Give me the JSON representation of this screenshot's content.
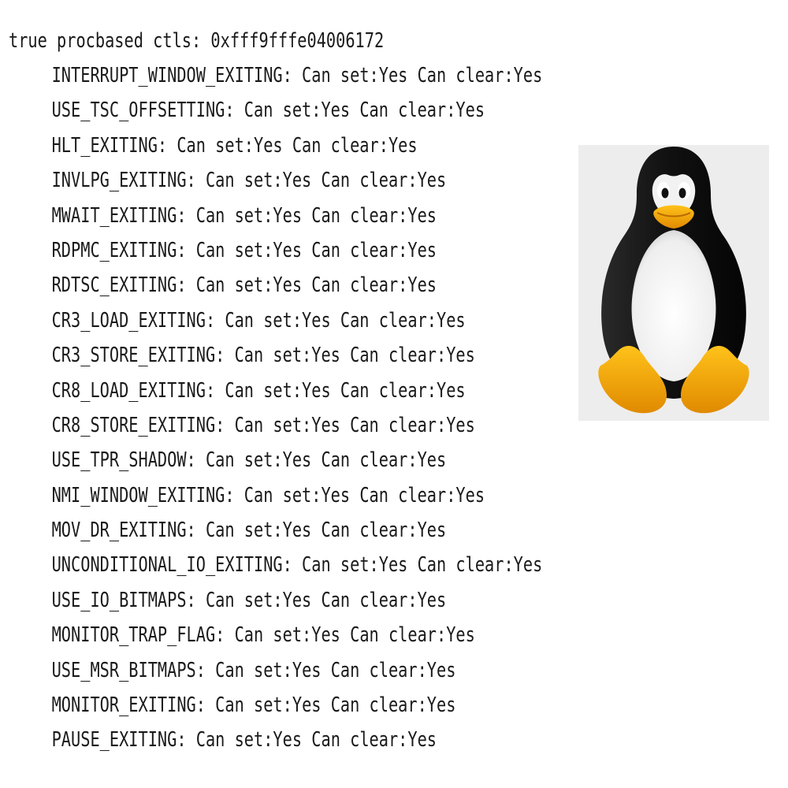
{
  "output": {
    "header": "true procbased ctls: 0xfff9fffe04006172",
    "controls": [
      {
        "name": "INTERRUPT_WINDOW_EXITING",
        "status": "Can set:Yes Can clear:Yes"
      },
      {
        "name": "USE_TSC_OFFSETTING",
        "status": "Can set:Yes Can clear:Yes"
      },
      {
        "name": "HLT_EXITING",
        "status": "Can set:Yes Can clear:Yes"
      },
      {
        "name": "INVLPG_EXITING",
        "status": "Can set:Yes Can clear:Yes"
      },
      {
        "name": "MWAIT_EXITING",
        "status": "Can set:Yes Can clear:Yes"
      },
      {
        "name": "RDPMC_EXITING",
        "status": "Can set:Yes Can clear:Yes"
      },
      {
        "name": "RDTSC_EXITING",
        "status": "Can set:Yes Can clear:Yes"
      },
      {
        "name": "CR3_LOAD_EXITING",
        "status": "Can set:Yes Can clear:Yes"
      },
      {
        "name": "CR3_STORE_EXITING",
        "status": "Can set:Yes Can clear:Yes"
      },
      {
        "name": "CR8_LOAD_EXITING",
        "status": "Can set:Yes Can clear:Yes"
      },
      {
        "name": "CR8_STORE_EXITING",
        "status": "Can set:Yes Can clear:Yes"
      },
      {
        "name": "USE_TPR_SHADOW",
        "status": "Can set:Yes Can clear:Yes"
      },
      {
        "name": "NMI_WINDOW_EXITING",
        "status": "Can set:Yes Can clear:Yes"
      },
      {
        "name": "MOV_DR_EXITING",
        "status": "Can set:Yes Can clear:Yes"
      },
      {
        "name": "UNCONDITIONAL_IO_EXITING",
        "status": "Can set:Yes Can clear:Yes"
      },
      {
        "name": "USE_IO_BITMAPS",
        "status": "Can set:Yes Can clear:Yes"
      },
      {
        "name": "MONITOR_TRAP_FLAG",
        "status": "Can set:Yes Can clear:Yes"
      },
      {
        "name": "USE_MSR_BITMAPS",
        "status": "Can set:Yes Can clear:Yes"
      },
      {
        "name": "MONITOR_EXITING",
        "status": "Can set:Yes Can clear:Yes"
      },
      {
        "name": "PAUSE_EXITING",
        "status": "Can set:Yes Can clear:Yes"
      }
    ]
  },
  "mascot": {
    "icon": "tux-penguin-icon"
  },
  "colors": {
    "text": "#1a1a1a",
    "background": "#ffffff",
    "mascot_background": "#ededed",
    "beak_feet": "#f5a80c"
  }
}
